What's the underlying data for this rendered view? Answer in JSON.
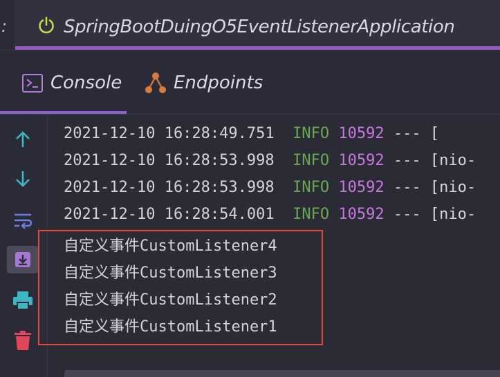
{
  "run_bar": {
    "prefix": ":",
    "tab_title": "SpringBootDuingO5EventListenerApplication",
    "tab_icon": "power-icon"
  },
  "tool_tabs": [
    {
      "label": "Console",
      "icon": "console-icon",
      "active": true
    },
    {
      "label": "Endpoints",
      "icon": "endpoints-icon",
      "active": false
    }
  ],
  "toolbar": [
    {
      "name": "scroll-up-arrow-icon",
      "glyph": "up"
    },
    {
      "name": "scroll-down-arrow-icon",
      "glyph": "down"
    },
    {
      "name": "soft-wrap-icon",
      "glyph": "wrap"
    },
    {
      "name": "scroll-to-end-icon",
      "glyph": "scroll-end",
      "selected": true
    },
    {
      "name": "print-icon",
      "glyph": "print"
    },
    {
      "name": "clear-all-trash-icon",
      "glyph": "trash"
    }
  ],
  "log_lines": [
    {
      "timestamp": "2021-12-10 16:28:49.751",
      "level": "INFO",
      "pid": "10592",
      "rest": " --- ["
    },
    {
      "timestamp": "2021-12-10 16:28:53.998",
      "level": "INFO",
      "pid": "10592",
      "rest": " --- [nio-"
    },
    {
      "timestamp": "2021-12-10 16:28:53.998",
      "level": "INFO",
      "pid": "10592",
      "rest": " --- [nio-"
    },
    {
      "timestamp": "2021-12-10 16:28:54.001",
      "level": "INFO",
      "pid": "10592",
      "rest": " --- [nio-"
    }
  ],
  "custom_lines": [
    "自定义事件CustomListener4",
    "自定义事件CustomListener3",
    "自定义事件CustomListener2",
    "自定义事件CustomListener1"
  ],
  "colors": {
    "info": "#6aa84f",
    "pid": "#c678dd",
    "highlight_border": "#e24a3d",
    "accent_tab": "#9b59c6"
  }
}
